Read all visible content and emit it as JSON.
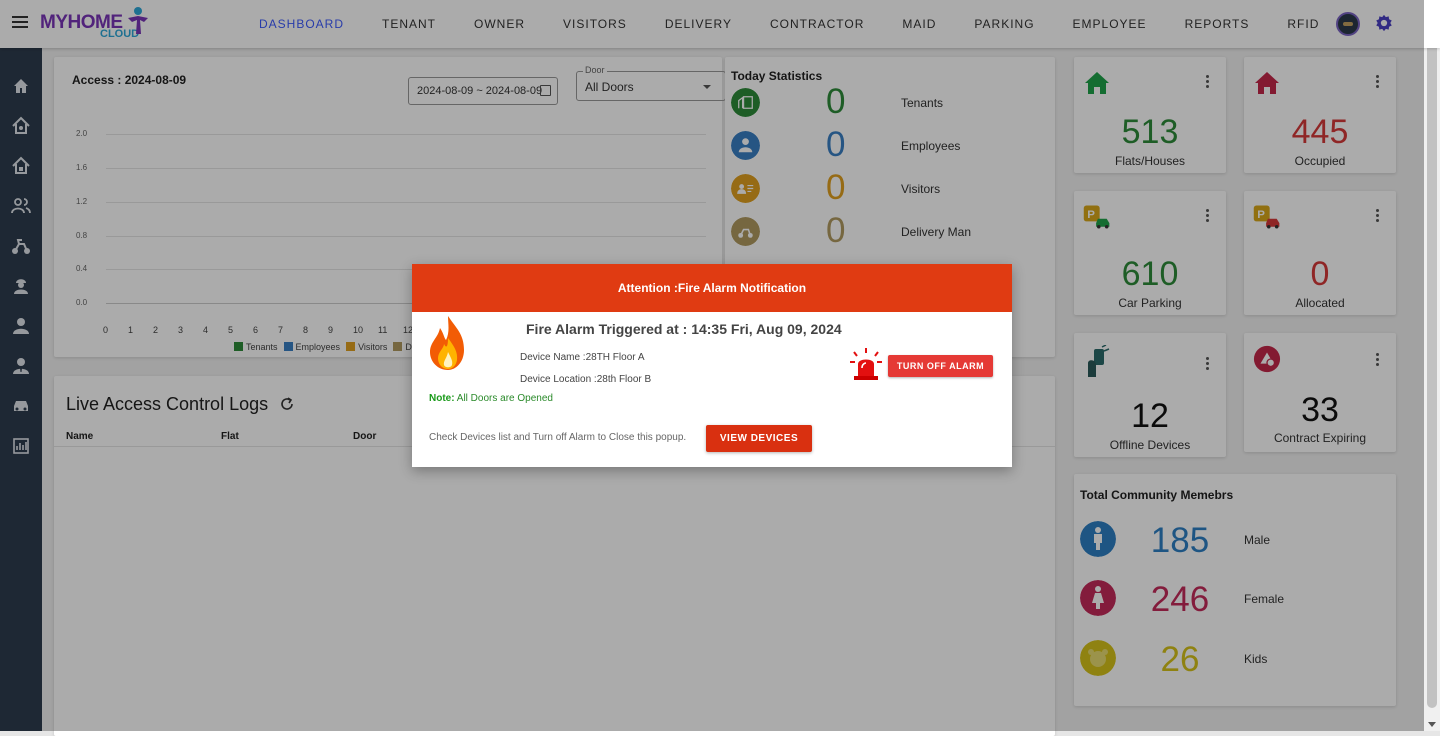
{
  "app": {
    "logo_main": "MYHOME",
    "logo_sub": "CLOUD"
  },
  "nav": [
    "DASHBOARD",
    "TENANT",
    "OWNER",
    "VISITORS",
    "DELIVERY",
    "CONTRACTOR",
    "MAID",
    "PARKING",
    "EMPLOYEE",
    "REPORTS",
    "RFID"
  ],
  "access": {
    "title": "Access : 2024-08-09",
    "date_range": "2024-08-09 ~ 2024-08-09",
    "door_label": "Door",
    "door_value": "All Doors"
  },
  "chart_data": {
    "type": "bar",
    "categories": [
      "0",
      "1",
      "2",
      "3",
      "4",
      "5",
      "6",
      "7",
      "8",
      "9",
      "10",
      "11",
      "12"
    ],
    "series": [
      {
        "name": "Tenants",
        "values": [
          0,
          0,
          0,
          0,
          0,
          0,
          0,
          0,
          0,
          0,
          0,
          0,
          0
        ]
      },
      {
        "name": "Employees",
        "values": [
          0,
          0,
          0,
          0,
          0,
          0,
          0,
          0,
          0,
          0,
          0,
          0,
          0
        ]
      },
      {
        "name": "Visitors",
        "values": [
          0,
          0,
          0,
          0,
          0,
          0,
          0,
          0,
          0,
          0,
          0,
          0,
          0
        ]
      },
      {
        "name": "Deliv",
        "values": [
          0,
          0,
          0,
          0,
          0,
          0,
          0,
          0,
          0,
          0,
          0,
          0,
          0
        ]
      }
    ],
    "yticks": [
      "2.0",
      "1.6",
      "1.2",
      "0.8",
      "0.4",
      "0.0"
    ],
    "ylim": [
      0,
      2.0
    ],
    "colors": [
      "#2e8b3a",
      "#3a7fc4",
      "#e0a020",
      "#b09a60"
    ]
  },
  "today": {
    "title": "Today Statistics",
    "rows": [
      {
        "value": "0",
        "label": "Tenants",
        "color": "#2e8b3a"
      },
      {
        "value": "0",
        "label": "Employees",
        "color": "#3a7fc4"
      },
      {
        "value": "0",
        "label": "Visitors",
        "color": "#e0a020"
      },
      {
        "value": "0",
        "label": "Delivery Man",
        "color": "#b09a60"
      }
    ]
  },
  "live": {
    "title": "Live Access Control Logs",
    "columns": [
      "Name",
      "Flat",
      "Door"
    ]
  },
  "tiles": [
    {
      "value": "513",
      "caption": "Flats/Houses",
      "color": "#2e8b3a"
    },
    {
      "value": "445",
      "caption": "Occupied",
      "color": "#d63a3a"
    },
    {
      "value": "610",
      "caption": "Car Parking",
      "color": "#2e8b3a"
    },
    {
      "value": "0",
      "caption": "Allocated",
      "color": "#d63a3a"
    },
    {
      "value": "12",
      "caption": "Offline Devices",
      "color": "#111111"
    },
    {
      "value": "33",
      "caption": "Contract Expiring",
      "color": "#111111"
    }
  ],
  "community": {
    "title": "Total Community Memebrs",
    "rows": [
      {
        "value": "185",
        "label": "Male",
        "color": "#2e7fc4"
      },
      {
        "value": "246",
        "label": "Female",
        "color": "#c42a5a"
      },
      {
        "value": "26",
        "label": "Kids",
        "color": "#d6c21a"
      }
    ]
  },
  "modal": {
    "header": "Attention :Fire Alarm Notification",
    "title": "Fire Alarm Triggered at : 14:35 Fri, Aug 09, 2024",
    "device_name": "Device Name :28TH Floor A",
    "device_location": "Device Location :28th Floor B",
    "turn_off": "TURN OFF ALARM",
    "note_label": "Note:",
    "note_text": " All Doors are Opened",
    "check_text": "Check Devices list and Turn off Alarm to Close this popup.",
    "view_devices": "VIEW DEVICES"
  }
}
